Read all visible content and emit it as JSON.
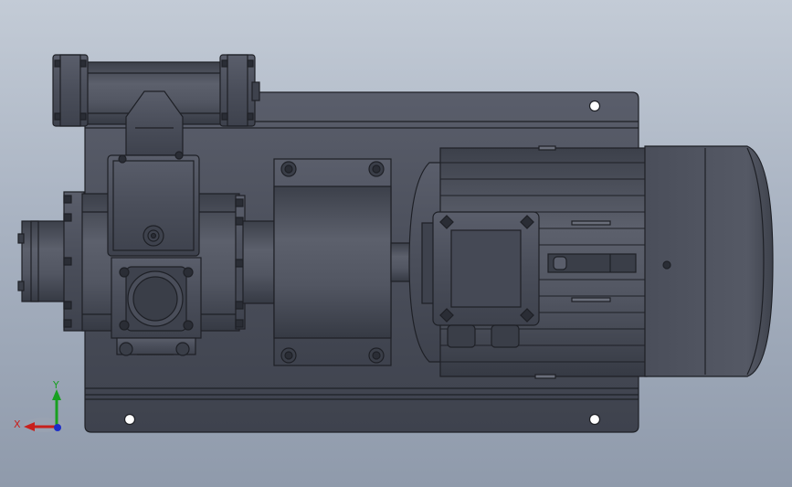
{
  "viewport": {
    "background_top": "#c3cbd6",
    "background_bottom": "#8f9aab",
    "model_color": "#4a4e5a",
    "edge_color": "#1e2026"
  },
  "triad": {
    "x_label": "X",
    "y_label": "Y",
    "x_color": "#c8201c",
    "y_color": "#18a020",
    "z_color": "#1c2ec8"
  },
  "model_parts": {
    "base": "base-plate-icon",
    "pump": "gear-pump-icon",
    "coupling": "coupling-housing-icon",
    "motor": "electric-motor-icon",
    "terminal_box": "terminal-box-icon",
    "fan_cover": "fan-cover-icon"
  }
}
